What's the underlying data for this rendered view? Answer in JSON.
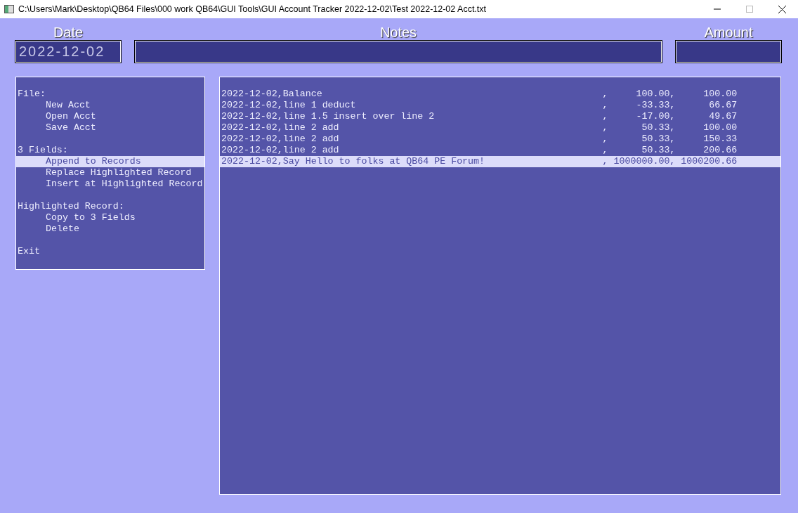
{
  "window": {
    "title": "C:\\Users\\Mark\\Desktop\\QB64 Files\\000 work QB64\\GUI Tools\\GUI Account Tracker 2022-12-02\\Test 2022-12-02 Acct.txt"
  },
  "fields": [
    {
      "label": "Date",
      "value": "2022-12-02"
    },
    {
      "label": "Notes"
    },
    {
      "label": "Amount"
    }
  ],
  "menu": [
    {
      "kind": "heading",
      "label": "File:"
    },
    {
      "kind": "command",
      "label": "New Acct",
      "selected": false
    },
    {
      "kind": "command",
      "label": "Open Acct",
      "selected": false
    },
    {
      "kind": "command",
      "label": "Save Acct",
      "selected": false
    },
    {
      "kind": "gap"
    },
    {
      "kind": "heading",
      "label": "3 Fields:"
    },
    {
      "kind": "command",
      "label": "Append to Records",
      "selected": true
    },
    {
      "kind": "command",
      "label": "Replace Highlighted Record",
      "selected": false
    },
    {
      "kind": "command",
      "label": "Insert at Highlighted Record",
      "selected": false
    },
    {
      "kind": "gap"
    },
    {
      "kind": "heading",
      "label": "Highlighted Record:"
    },
    {
      "kind": "command",
      "label": "Copy to 3 Fields",
      "selected": false
    },
    {
      "kind": "command",
      "label": "Delete",
      "selected": false
    },
    {
      "kind": "gap"
    },
    {
      "kind": "top-command",
      "label": "Exit",
      "selected": false
    }
  ],
  "records": [
    {
      "text": "2022-12-02,Balance",
      "amount": ",     100.00,",
      "balance": "100.00",
      "selected": false
    },
    {
      "text": "2022-12-02,line 1 deduct",
      "amount": ",     -33.33,",
      "balance": "66.67",
      "selected": false
    },
    {
      "text": "2022-12-02,line 1.5 insert over line 2",
      "amount": ",     -17.00,",
      "balance": "49.67",
      "selected": false
    },
    {
      "text": "2022-12-02,line 2 add",
      "amount": ",      50.33,",
      "balance": "100.00",
      "selected": false
    },
    {
      "text": "2022-12-02,line 2 add",
      "amount": ",      50.33,",
      "balance": "150.33",
      "selected": false
    },
    {
      "text": "2022-12-02,line 2 add",
      "amount": ",      50.33,",
      "balance": "200.66",
      "selected": false
    },
    {
      "text": "2022-12-02,Say Hello to folks at QB64 PE Forum!",
      "amount": ", 1000000.00,",
      "balance": "1000200.66",
      "selected": true
    }
  ]
}
